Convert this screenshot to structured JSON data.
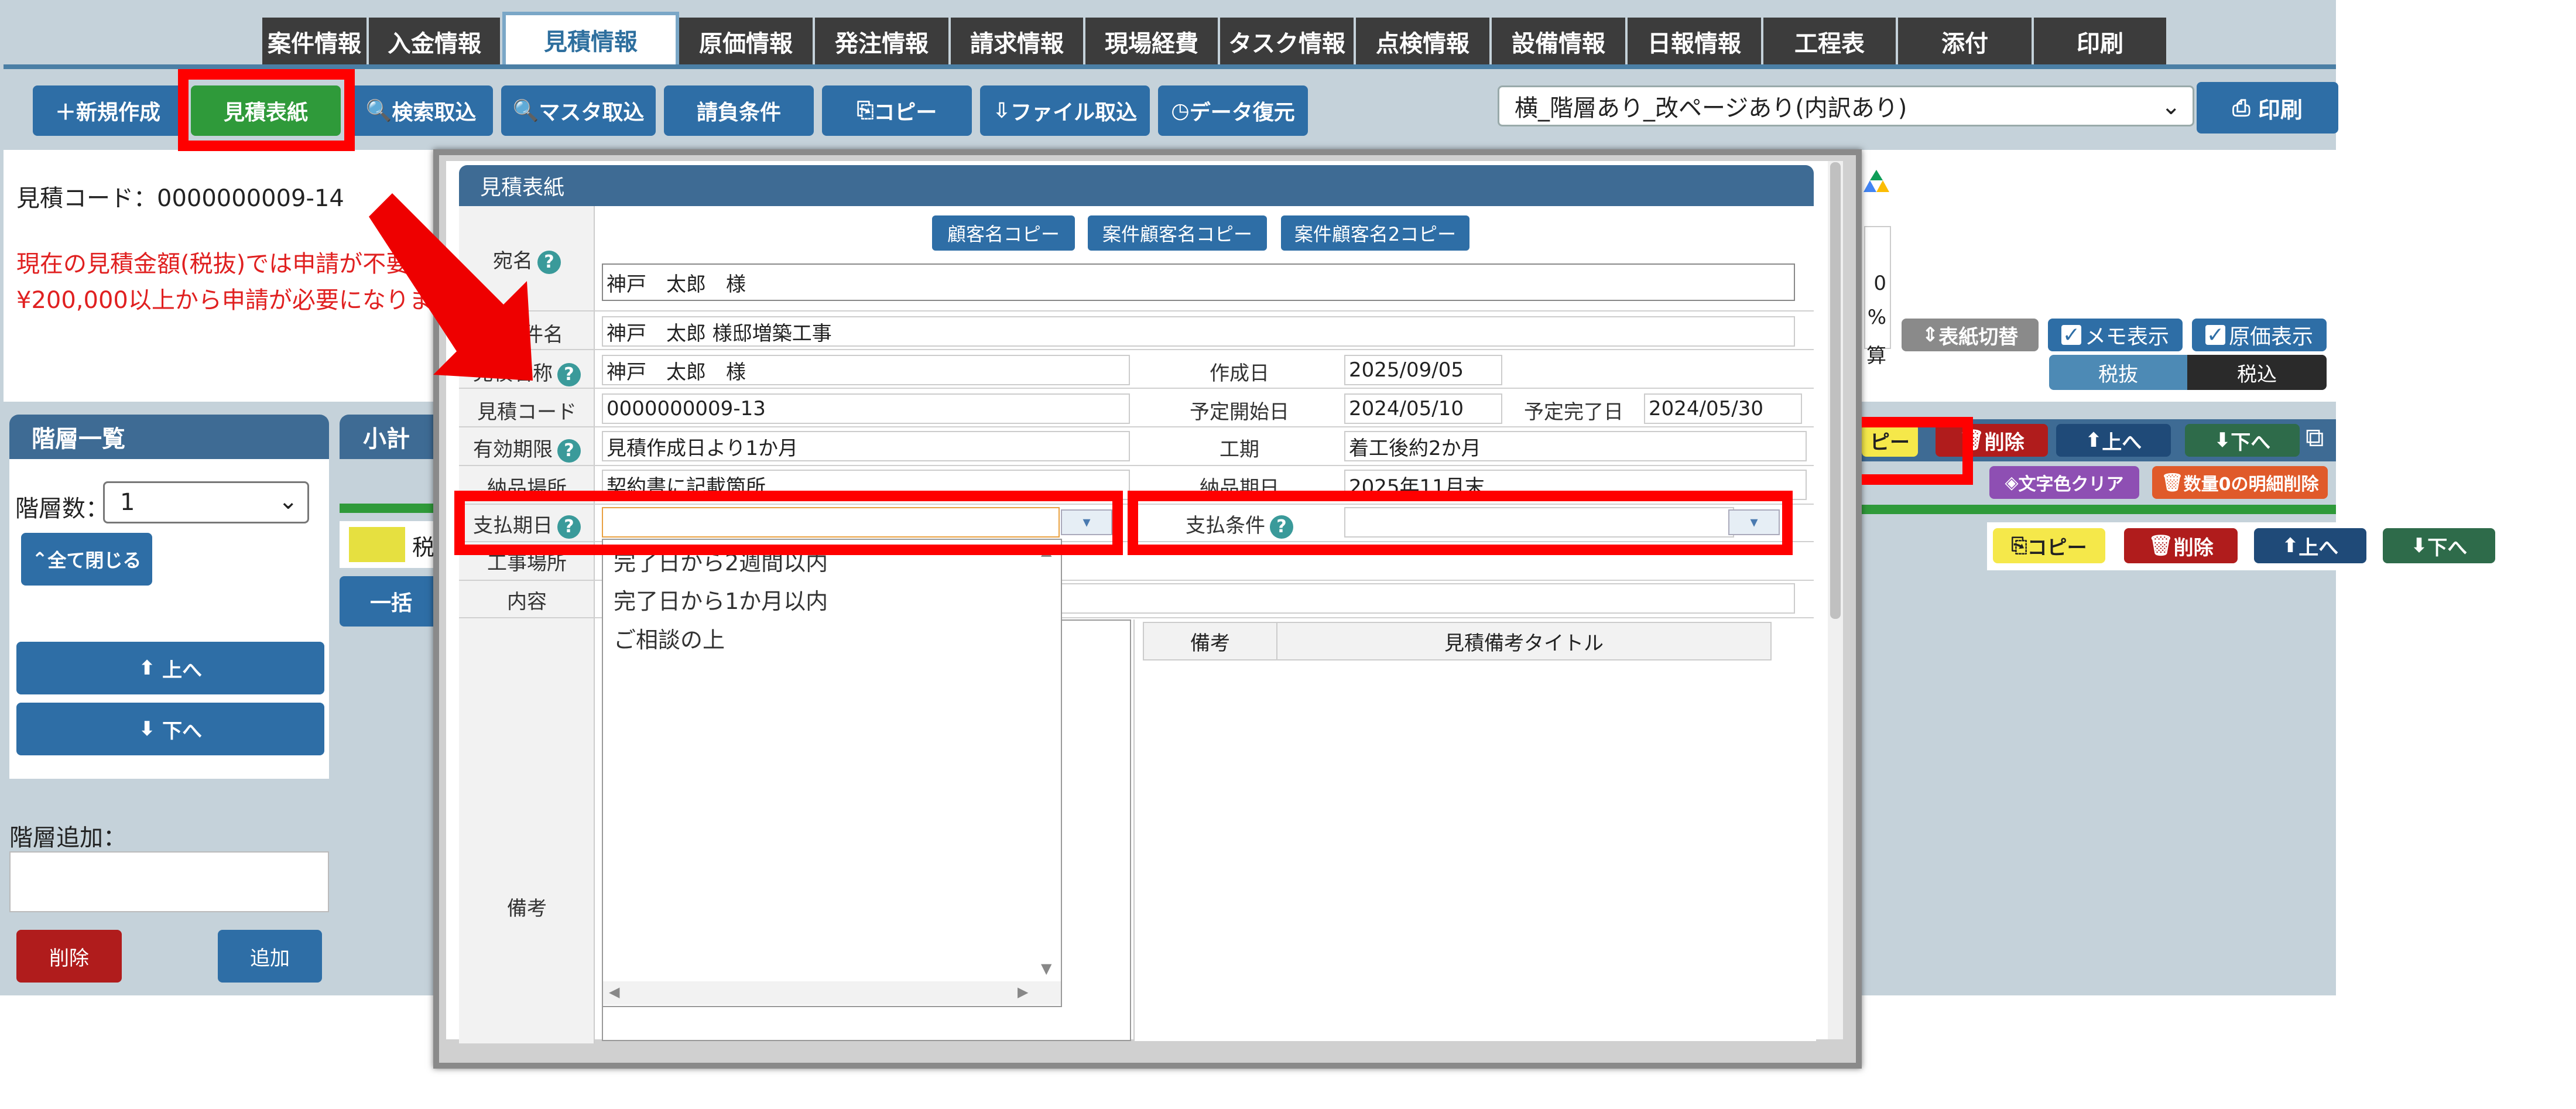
{
  "tabs": [
    "案件情報",
    "入金情報",
    "見積情報",
    "原価情報",
    "発注情報",
    "請求情報",
    "現場経費",
    "タスク情報",
    "点検情報",
    "設備情報",
    "日報情報",
    "工程表",
    "添付",
    "印刷"
  ],
  "active_tab": "見積情報",
  "toolbar": {
    "new": "新規作成",
    "cover": "見積表紙",
    "search_import": "検索取込",
    "master_import": "マスタ取込",
    "terms": "請負条件",
    "copy": "コピー",
    "file_import": "ファイル取込",
    "restore": "データ復元",
    "template": "横_階層あり_改ページあり(内訳あり)",
    "print": "印刷"
  },
  "info": {
    "code": "見積コード：0000000009-14",
    "warn_line1": "現在の見積金額(税抜)では申請が不要",
    "warn_line2": "¥200,000以上から申請が必要になりま"
  },
  "right_controls": {
    "cover_switch": "表紙切替",
    "memo_show": "メモ表示",
    "cost_show": "原価表示",
    "tax_excl": "税抜",
    "tax_incl": "税込",
    "copy_partial": "ピー",
    "delete": "削除",
    "up": "上へ",
    "down": "下へ",
    "clear_color": "文字色クリア",
    "delete_zero": "数量0の明細削除",
    "copy": "コピー",
    "delete2": "削除",
    "up2": "上へ",
    "down2": "下へ",
    "cell1": "0",
    "cell2": "%",
    "cell3": "算"
  },
  "sidebar": {
    "title": "階層一覧",
    "count_label": "階層数：",
    "count_value": "1",
    "collapse_all": "全て閉じる",
    "up": "上へ",
    "down": "下へ",
    "add_label": "階層追加：",
    "delete": "削除",
    "add": "追加",
    "subtotal": "小計",
    "tax_partial": "税",
    "bulk_partial": "一括"
  },
  "modal": {
    "title": "見積表紙",
    "copy_customer": "顧客名コピー",
    "copy_case_customer": "案件顧客名コピー",
    "copy_case_customer2": "案件顧客名2コピー",
    "labels": {
      "addressee": "宛名",
      "case_name": "件名",
      "estimate_name": "見積名称",
      "estimate_code": "見積コード",
      "validity": "有効期限",
      "delivery_place": "納品場所",
      "payment_due": "支払期日",
      "work_place": "工事場所",
      "content": "内容",
      "remarks": "備考",
      "created": "作成日",
      "start_date": "予定開始日",
      "end_date": "予定完了日",
      "period": "工期",
      "delivery_date": "納品期日",
      "payment_terms": "支払条件"
    },
    "values": {
      "addressee": "神戸　太郎　様",
      "case_name": "神戸　太郎 様邸増築工事",
      "estimate_name": "神戸　太郎　様",
      "estimate_code": "0000000009-13",
      "validity": "見積作成日より1か月",
      "delivery_place": "契約書に記載箇所",
      "created": "2025/09/05",
      "start_date": "2024/05/10",
      "end_date": "2024/05/30",
      "period": "着工後約2か月",
      "delivery_date": "2025年11月末"
    },
    "dropdown_options": [
      "完了日から2週間以内",
      "完了日から1か月以内",
      "ご相談の上"
    ],
    "notes_table": {
      "col1": "備考",
      "col2": "見積備考タイトル"
    }
  }
}
